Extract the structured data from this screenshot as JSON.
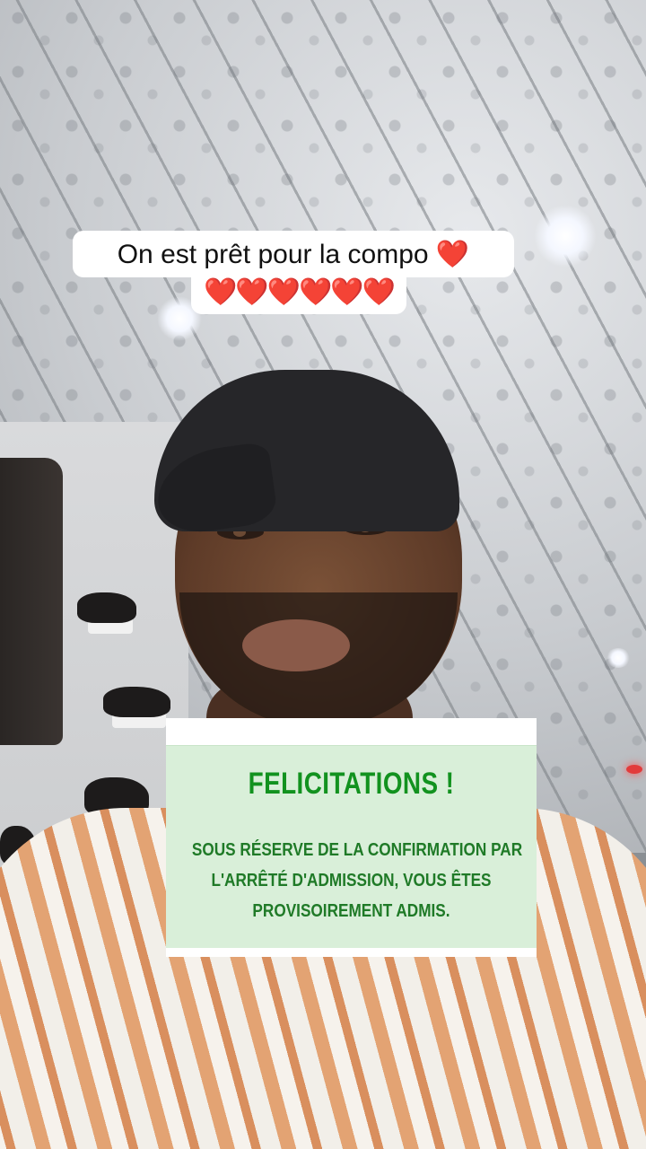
{
  "caption": {
    "line1": "On est prêt pour la compo ❤️",
    "line2": "❤️❤️❤️❤️❤️❤️"
  },
  "result_card": {
    "title": "FELICITATIONS !",
    "body_lines": [
      "SOUS RÉSERVE DE LA CONFIRMATION PAR",
      "L'ARRÊTÉ D'ADMISSION, VOUS ÊTES",
      "PROVISOIREMENT ADMIS."
    ]
  },
  "colors": {
    "card_background": "#d9efd9",
    "title_green": "#12921f",
    "body_green": "#1f7a27",
    "heart_red": "#d8252f"
  }
}
